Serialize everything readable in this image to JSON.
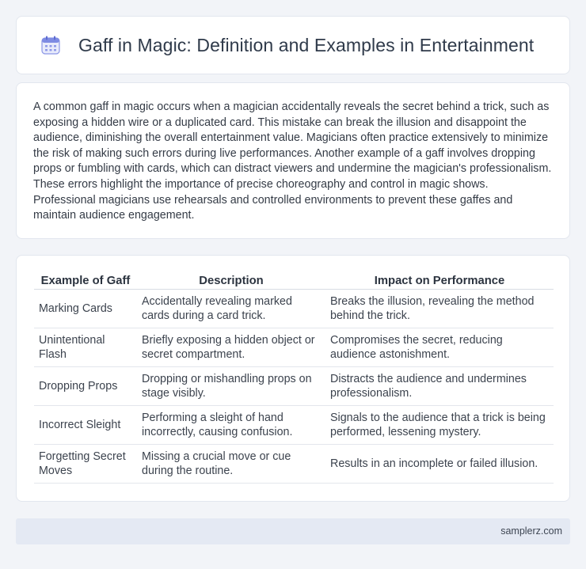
{
  "header": {
    "title": "Gaff in Magic: Definition and Examples in Entertainment",
    "icon": "calendar-icon",
    "icon_color": "#6b7bd8"
  },
  "intro": {
    "text": "A common gaff in magic occurs when a magician accidentally reveals the secret behind a trick, such as exposing a hidden wire or a duplicated card. This mistake can break the illusion and disappoint the audience, diminishing the overall entertainment value. Magicians often practice extensively to minimize the risk of making such errors during live performances. Another example of a gaff involves dropping props or fumbling with cards, which can distract viewers and undermine the magician's professionalism. These errors highlight the importance of precise choreography and control in magic shows. Professional magicians use rehearsals and controlled environments to prevent these gaffes and maintain audience engagement."
  },
  "table": {
    "headers": [
      "Example of Gaff",
      "Description",
      "Impact on Performance"
    ],
    "rows": [
      [
        "Marking Cards",
        "Accidentally revealing marked cards during a card trick.",
        "Breaks the illusion, revealing the method behind the trick."
      ],
      [
        "Unintentional Flash",
        "Briefly exposing a hidden object or secret compartment.",
        "Compromises the secret, reducing audience astonishment."
      ],
      [
        "Dropping Props",
        "Dropping or mishandling props on stage visibly.",
        "Distracts the audience and undermines professionalism."
      ],
      [
        "Incorrect Sleight",
        "Performing a sleight of hand incorrectly, causing confusion.",
        "Signals to the audience that a trick is being performed, lessening mystery."
      ],
      [
        "Forgetting Secret Moves",
        "Missing a crucial move or cue during the routine.",
        "Results in an incomplete or failed illusion."
      ]
    ]
  },
  "footer": {
    "site": "samplerz.com"
  }
}
